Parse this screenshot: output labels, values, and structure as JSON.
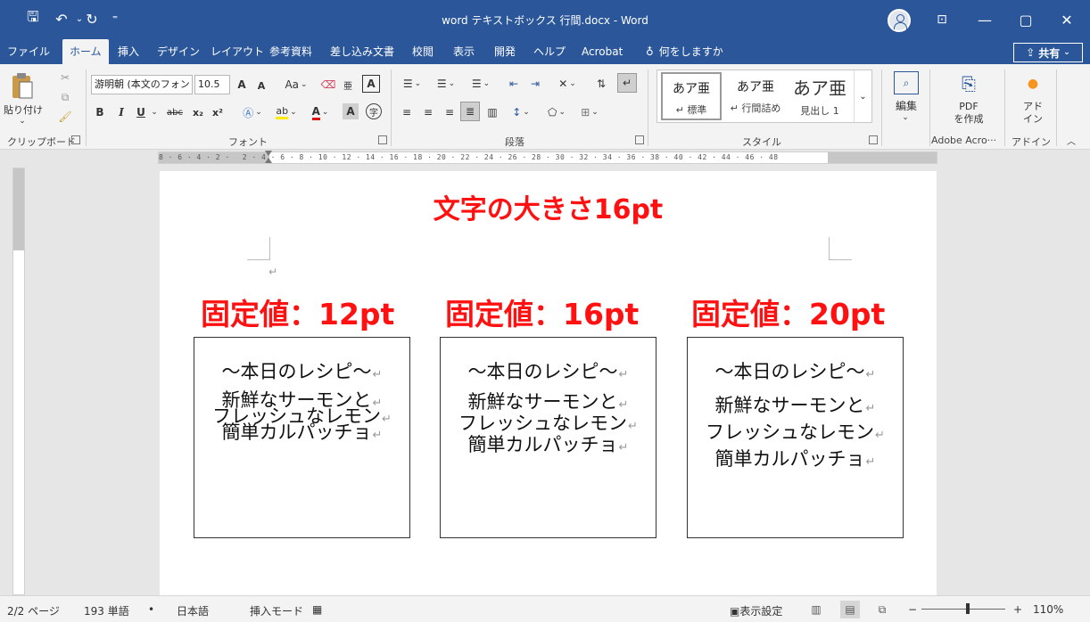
{
  "window": {
    "title": "word テキストボックス 行間.docx  -  Word",
    "controls": {
      "minimize": "—",
      "restore": "▢",
      "close": "✕"
    }
  },
  "qat": {
    "save": "🖫",
    "undo": "↶",
    "redo": "↻",
    "customize": "⁼"
  },
  "tabs": [
    "ファイル",
    "ホーム",
    "挿入",
    "デザイン",
    "レイアウト",
    "参考資料",
    "差し込み文書",
    "校閲",
    "表示",
    "開発",
    "ヘルプ",
    "Acrobat"
  ],
  "active_tab": "ホーム",
  "tell_me": "何をしますか",
  "share": "共有",
  "ribbon": {
    "clipboard": {
      "paste": "貼り付け",
      "label": "クリップボード"
    },
    "font": {
      "name": "游明朝 (本文のフォン",
      "size": "10.5",
      "grow": "A",
      "shrink": "A",
      "case": "Aa",
      "bold": "B",
      "italic": "I",
      "underline": "U",
      "strike": "abc",
      "subscript": "x₂",
      "superscript": "x²",
      "label": "フォント"
    },
    "paragraph": {
      "label": "段落"
    },
    "styles": {
      "items": [
        {
          "preview": "あア亜",
          "name": "↵ 標準"
        },
        {
          "preview": "あア亜",
          "name": "↵ 行間詰め"
        },
        {
          "preview": "あア亜",
          "name": "見出し 1"
        }
      ],
      "label": "スタイル"
    },
    "editing": {
      "label": "編集"
    },
    "pdf": {
      "label": "PDF\nを作成",
      "group": "Adobe Acro···"
    },
    "addins": {
      "label": "アド\nイン",
      "group": "アドイン"
    }
  },
  "ruler": {
    "left_marks": "8 · 6 · 4 · 2 ·",
    "marks": "2 · 4 · 6 · 8 · 10 · 12 · 14 · 16 · 18 · 20 · 22 · 24 · 26 · 28 · 30 · 32 · 34 · 36 · 38 · 40 · 42 · 44 · 46 · 48"
  },
  "document": {
    "heading": "文字の大きさ16pt",
    "paragraph_mark": "↵",
    "boxes": [
      {
        "label": "固定値：12pt",
        "title": "～本日のレシピ～",
        "lines": [
          "新鮮なサーモンと",
          "フレッシュなレモン",
          "簡単カルパッチョ"
        ]
      },
      {
        "label": "固定値：16pt",
        "title": "～本日のレシピ～",
        "lines": [
          "新鮮なサーモンと",
          "フレッシュなレモン",
          "簡単カルパッチョ"
        ]
      },
      {
        "label": "固定値：20pt",
        "title": "～本日のレシピ～",
        "lines": [
          "新鮮なサーモンと",
          "フレッシュなレモン",
          "簡単カルパッチョ"
        ]
      }
    ]
  },
  "status": {
    "page": "2/2 ページ",
    "words": "193 単語",
    "language": "日本語",
    "mode": "挿入モード",
    "display_settings": "表示設定",
    "zoom": "110%",
    "zoom_minus": "−",
    "zoom_plus": "+"
  },
  "colors": {
    "accent": "#2b579a",
    "heading_red": "#ff1111"
  }
}
